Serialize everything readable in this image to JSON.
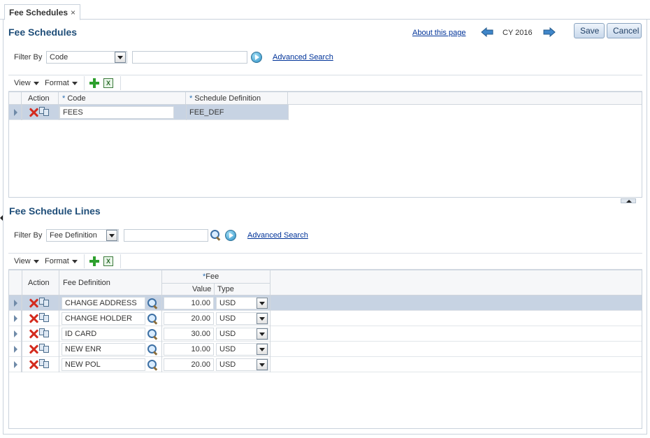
{
  "tab": {
    "label": "Fee Schedules",
    "close": "×"
  },
  "header": {
    "title": "Fee Schedules",
    "about_link": "About this page",
    "year": "CY 2016",
    "save": "Save",
    "cancel": "Cancel"
  },
  "filter1": {
    "label": "Filter By",
    "selected": "Code",
    "value": "",
    "advanced": "Advanced Search"
  },
  "toolbar1": {
    "view": "View",
    "format": "Format"
  },
  "schedules": {
    "columns": {
      "action": "Action",
      "code_req": "*",
      "code": "Code",
      "def_req": "*",
      "def": "Schedule Definition"
    },
    "rows": [
      {
        "code": "FEES",
        "definition": "FEE_DEF"
      }
    ]
  },
  "lines_title": "Fee Schedule Lines",
  "filter2": {
    "label": "Filter By",
    "selected": "Fee Definition",
    "value": "",
    "advanced": "Advanced Search"
  },
  "toolbar2": {
    "view": "View",
    "format": "Format"
  },
  "lines": {
    "columns": {
      "action": "Action",
      "fee_def": "Fee Definition",
      "fee_req": "*",
      "fee": "Fee",
      "value": "Value",
      "type": "Type"
    },
    "rows": [
      {
        "definition": "CHANGE ADDRESS",
        "value": "10.00",
        "type": "USD"
      },
      {
        "definition": "CHANGE HOLDER",
        "value": "20.00",
        "type": "USD"
      },
      {
        "definition": "ID CARD",
        "value": "30.00",
        "type": "USD"
      },
      {
        "definition": "NEW ENR",
        "value": "10.00",
        "type": "USD"
      },
      {
        "definition": "NEW POL",
        "value": "20.00",
        "type": "USD"
      }
    ]
  },
  "colors": {
    "title": "#1f4e79",
    "selected_row": "#c7d3e3",
    "link": "#003399"
  },
  "icons": [
    "close-icon",
    "prev-arrow-icon",
    "next-arrow-icon",
    "dropdown-icon",
    "go-icon",
    "add-icon",
    "export-excel-icon",
    "delete-icon",
    "duplicate-icon",
    "search-icon"
  ]
}
